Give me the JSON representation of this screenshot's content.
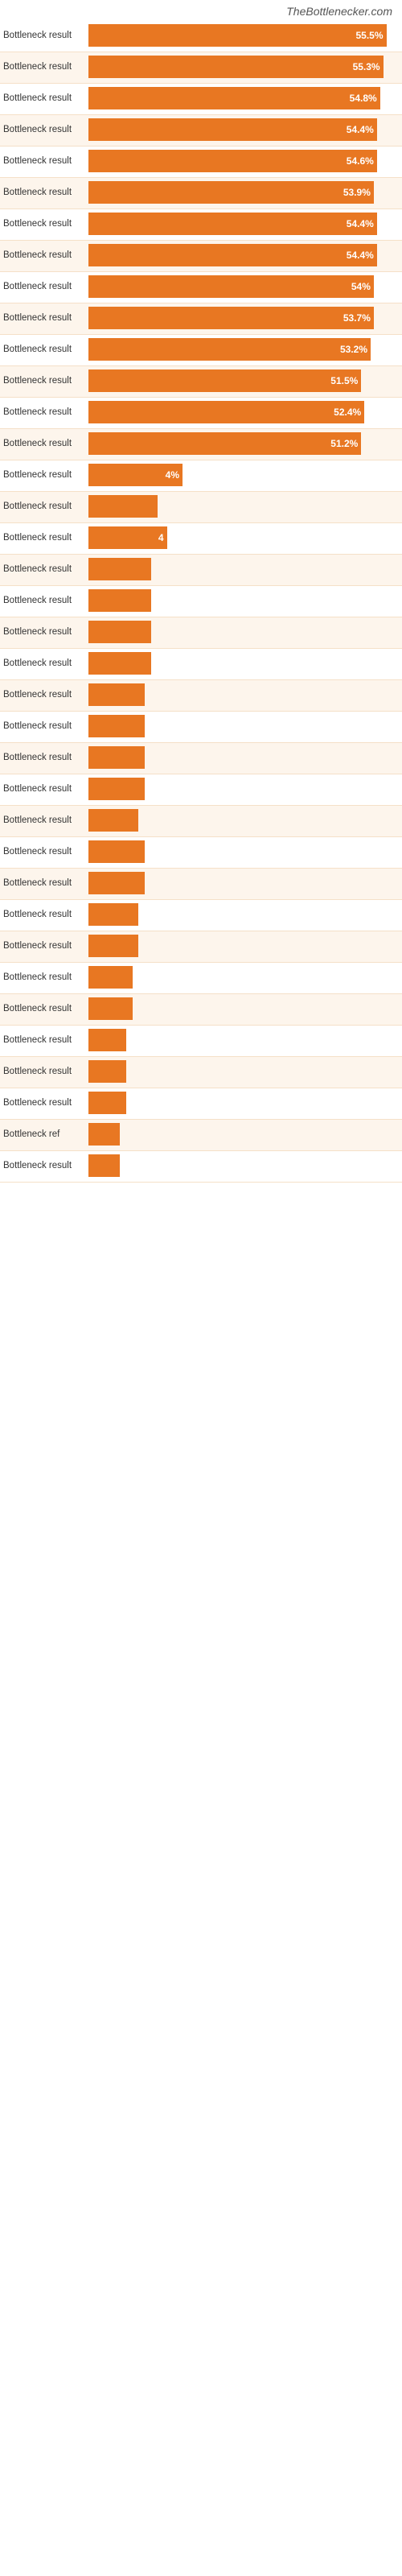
{
  "site": {
    "title": "TheBottlenecker.com"
  },
  "bars": [
    {
      "label": "Bottleneck result",
      "value": 55.5,
      "display": "55.5%",
      "width_pct": 95
    },
    {
      "label": "Bottleneck result",
      "value": 55.3,
      "display": "55.3%",
      "width_pct": 94
    },
    {
      "label": "Bottleneck result",
      "value": 54.8,
      "display": "54.8%",
      "width_pct": 93
    },
    {
      "label": "Bottleneck result",
      "value": 54.4,
      "display": "54.4%",
      "width_pct": 92
    },
    {
      "label": "Bottleneck result",
      "value": 54.6,
      "display": "54.6%",
      "width_pct": 92
    },
    {
      "label": "Bottleneck result",
      "value": 53.9,
      "display": "53.9%",
      "width_pct": 91
    },
    {
      "label": "Bottleneck result",
      "value": 54.4,
      "display": "54.4%",
      "width_pct": 92
    },
    {
      "label": "Bottleneck result",
      "value": 54.4,
      "display": "54.4%",
      "width_pct": 92
    },
    {
      "label": "Bottleneck result",
      "value": 54.0,
      "display": "54%",
      "width_pct": 91
    },
    {
      "label": "Bottleneck result",
      "value": 53.7,
      "display": "53.7%",
      "width_pct": 91
    },
    {
      "label": "Bottleneck result",
      "value": 53.2,
      "display": "53.2%",
      "width_pct": 90
    },
    {
      "label": "Bottleneck result",
      "value": 51.5,
      "display": "51.5%",
      "width_pct": 87
    },
    {
      "label": "Bottleneck result",
      "value": 52.4,
      "display": "52.4%",
      "width_pct": 88
    },
    {
      "label": "Bottleneck result",
      "value": 51.2,
      "display": "51.2%",
      "width_pct": 87
    },
    {
      "label": "Bottleneck result",
      "value": 4,
      "display": "4%",
      "width_pct": 30
    },
    {
      "label": "Bottleneck result",
      "value": null,
      "display": "",
      "width_pct": 22
    },
    {
      "label": "Bottleneck result",
      "value": 4,
      "display": "4",
      "width_pct": 25
    },
    {
      "label": "Bottleneck result",
      "value": null,
      "display": "",
      "width_pct": 20
    },
    {
      "label": "Bottleneck result",
      "value": null,
      "display": "",
      "width_pct": 20
    },
    {
      "label": "Bottleneck result",
      "value": null,
      "display": "",
      "width_pct": 20
    },
    {
      "label": "Bottleneck result",
      "value": null,
      "display": "",
      "width_pct": 20
    },
    {
      "label": "Bottleneck result",
      "value": null,
      "display": "",
      "width_pct": 18
    },
    {
      "label": "Bottleneck result",
      "value": null,
      "display": "",
      "width_pct": 18
    },
    {
      "label": "Bottleneck result",
      "value": null,
      "display": "",
      "width_pct": 18
    },
    {
      "label": "Bottleneck result",
      "value": null,
      "display": "",
      "width_pct": 18
    },
    {
      "label": "Bottleneck result",
      "value": null,
      "display": "",
      "width_pct": 16
    },
    {
      "label": "Bottleneck result",
      "value": null,
      "display": "",
      "width_pct": 18
    },
    {
      "label": "Bottleneck result",
      "value": null,
      "display": "",
      "width_pct": 18
    },
    {
      "label": "Bottleneck result",
      "value": null,
      "display": "",
      "width_pct": 16
    },
    {
      "label": "Bottleneck result",
      "value": null,
      "display": "",
      "width_pct": 16
    },
    {
      "label": "Bottleneck result",
      "value": null,
      "display": "",
      "width_pct": 14
    },
    {
      "label": "Bottleneck result",
      "value": null,
      "display": "",
      "width_pct": 14
    },
    {
      "label": "Bottleneck result",
      "value": null,
      "display": "",
      "width_pct": 12
    },
    {
      "label": "Bottleneck result",
      "value": null,
      "display": "",
      "width_pct": 12
    },
    {
      "label": "Bottleneck result",
      "value": null,
      "display": "",
      "width_pct": 12
    },
    {
      "label": "Bottleneck ref",
      "value": null,
      "display": "",
      "width_pct": 10
    },
    {
      "label": "Bottleneck result",
      "value": null,
      "display": "",
      "width_pct": 10
    }
  ]
}
